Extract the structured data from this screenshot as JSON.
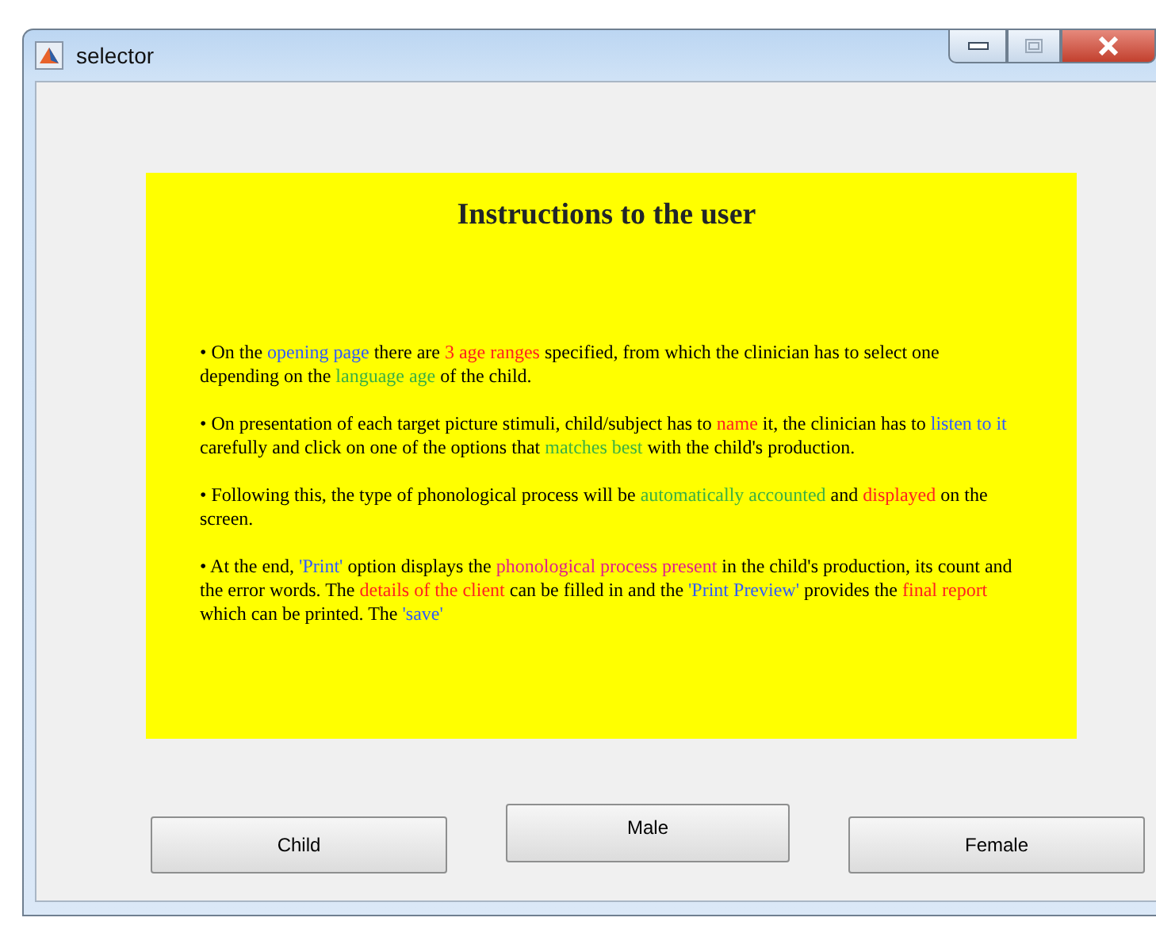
{
  "window": {
    "title": "selector"
  },
  "instructions": {
    "heading": "Instructions to the user",
    "paragraphs": [
      [
        {
          "text": "• On the "
        },
        {
          "text": "opening page",
          "color": "#2f5bff"
        },
        {
          "text": " there are "
        },
        {
          "text": "3 age ranges",
          "color": "#ff2020"
        },
        {
          "text": " specified, from which the clinician has to select one depending on the "
        },
        {
          "text": "language age",
          "color": "#3cb043"
        },
        {
          "text": " of the child."
        }
      ],
      [
        {
          "text": "• On presentation of each target picture stimuli, child/subject has to "
        },
        {
          "text": "name",
          "color": "#ff2020"
        },
        {
          "text": " it, the clinician has to "
        },
        {
          "text": "listen to it",
          "color": "#2f5bff"
        },
        {
          "text": " carefully and click on one of the options that "
        },
        {
          "text": "matches best",
          "color": "#3cb043"
        },
        {
          "text": " with the child's production."
        }
      ],
      [
        {
          "text": "• Following this, the type of phonological process will be "
        },
        {
          "text": "automatically accounted",
          "color": "#3cb043"
        },
        {
          "text": " and "
        },
        {
          "text": "displayed",
          "color": "#ff2020"
        },
        {
          "text": " on the screen."
        }
      ],
      [
        {
          "text": "• At the end, "
        },
        {
          "text": "'Print'",
          "color": "#2f5bff"
        },
        {
          "text": " option displays the "
        },
        {
          "text": "phonological process present",
          "color": "#e0208a"
        },
        {
          "text": " in the child's production, its count and the error words. The "
        },
        {
          "text": "details of the client",
          "color": "#ff2020"
        },
        {
          "text": " can be filled in and the "
        },
        {
          "text": "'Print Preview'",
          "color": "#2f5bff"
        },
        {
          "text": " provides the "
        },
        {
          "text": "final report",
          "color": "#ff2020"
        },
        {
          "text": " which can be printed. The "
        },
        {
          "text": "'save'",
          "color": "#2f5bff"
        }
      ]
    ]
  },
  "buttons": [
    {
      "label": "Child",
      "kind": "low"
    },
    {
      "label": "Male",
      "kind": "high"
    },
    {
      "label": "Female",
      "kind": "low"
    }
  ]
}
